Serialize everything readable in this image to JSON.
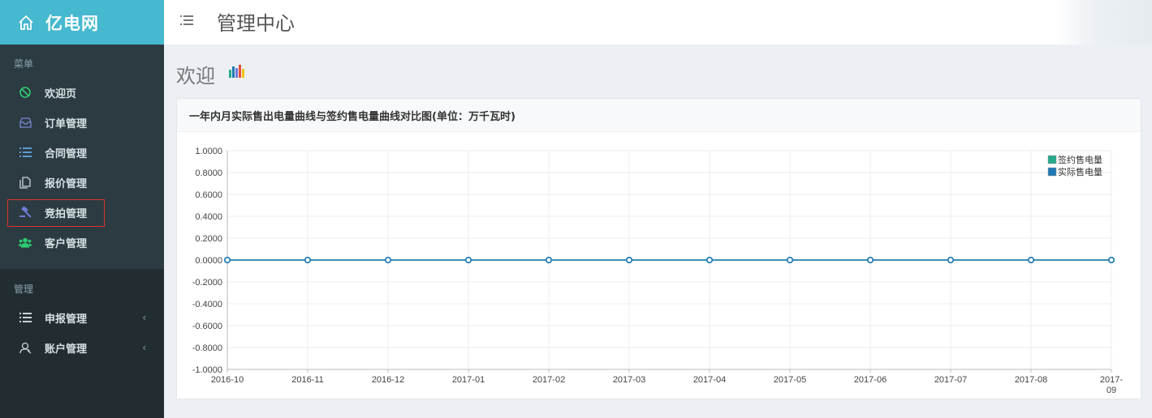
{
  "brand": {
    "name": "亿电网"
  },
  "header": {
    "title": "管理中心"
  },
  "sidebar": {
    "menu_title": "菜单",
    "items": [
      {
        "label": "欢迎页",
        "icon": "globe-icon"
      },
      {
        "label": "订单管理",
        "icon": "inbox-icon"
      },
      {
        "label": "合同管理",
        "icon": "list-icon"
      },
      {
        "label": "报价管理",
        "icon": "copy-icon"
      },
      {
        "label": "竞拍管理",
        "icon": "gavel-icon"
      },
      {
        "label": "客户管理",
        "icon": "users-icon"
      }
    ],
    "manage_title": "管理",
    "manage_items": [
      {
        "label": "申报管理",
        "icon": "list-icon"
      },
      {
        "label": "账户管理",
        "icon": "user-icon"
      }
    ]
  },
  "main": {
    "page_title": "欢迎",
    "panel_title": "一年内月实际售出电量曲线与签约售电量曲线对比图(单位：万千瓦时)"
  },
  "colors": {
    "sidebar": "#222d32",
    "brand": "#46b8cf",
    "series_signed": "#27a98b",
    "series_actual": "#1f78b4"
  },
  "chart_data": {
    "type": "line",
    "title": "一年内月实际售出电量曲线与签约售电量曲线对比图(单位：万千瓦时)",
    "categories": [
      "2016-10",
      "2016-11",
      "2016-12",
      "2017-01",
      "2017-02",
      "2017-03",
      "2017-04",
      "2017-05",
      "2017-06",
      "2017-07",
      "2017-08",
      "2017-09"
    ],
    "series": [
      {
        "name": "签约售电量",
        "color": "#27a98b",
        "values": [
          0,
          0,
          0,
          0,
          0,
          0,
          0,
          0,
          0,
          0,
          0,
          0
        ]
      },
      {
        "name": "实际售电量",
        "color": "#1f78b4",
        "values": [
          0,
          0,
          0,
          0,
          0,
          0,
          0,
          0,
          0,
          0,
          0,
          0
        ]
      }
    ],
    "ylim": [
      -1,
      1
    ],
    "yticks": [
      "1.0000",
      "0.8000",
      "0.6000",
      "0.4000",
      "0.2000",
      "0.0000",
      "-0.2000",
      "-0.4000",
      "-0.6000",
      "-0.8000",
      "-1.0000"
    ],
    "grid": true,
    "legend": "top-right"
  }
}
